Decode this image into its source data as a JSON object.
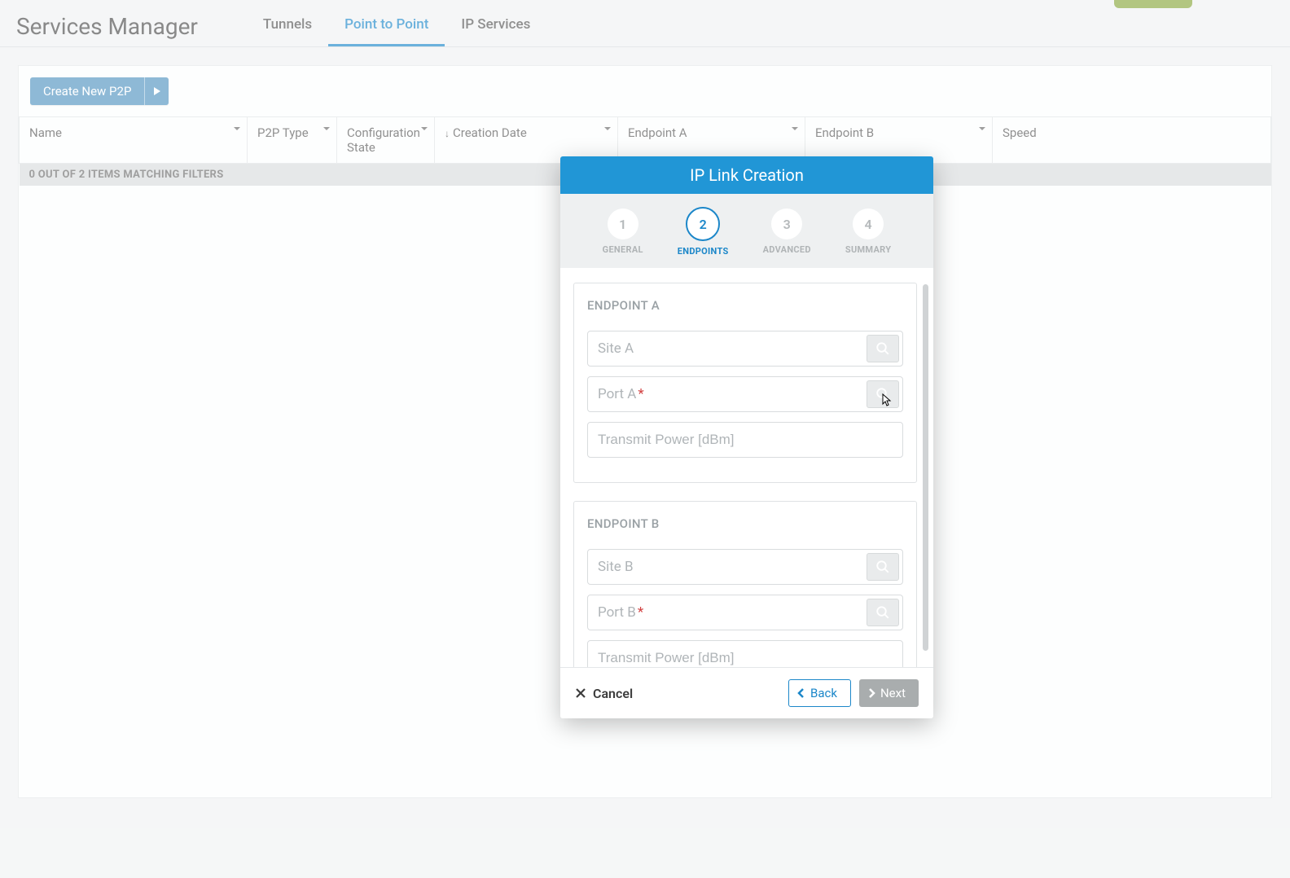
{
  "header": {
    "title": "Services Manager",
    "tabs": [
      "Tunnels",
      "Point to Point",
      "IP Services"
    ],
    "active_tab": 1
  },
  "toolbar": {
    "create_label": "Create New P2P"
  },
  "table": {
    "columns": [
      "Name",
      "P2P Type",
      "Configuration State",
      "Creation Date",
      "Endpoint A",
      "Endpoint B",
      "Speed"
    ],
    "sort_column": 3,
    "filter_text": "0 OUT OF 2 ITEMS MATCHING FILTERS"
  },
  "modal": {
    "title": "IP Link Creation",
    "steps": [
      {
        "num": "1",
        "label": "GENERAL"
      },
      {
        "num": "2",
        "label": "ENDPOINTS"
      },
      {
        "num": "3",
        "label": "ADVANCED"
      },
      {
        "num": "4",
        "label": "SUMMARY"
      }
    ],
    "active_step": 1,
    "endpoint_a": {
      "title": "ENDPOINT A",
      "site_ph": "Site A",
      "port_ph": "Port A",
      "tx_ph": "Transmit Power [dBm]"
    },
    "endpoint_b": {
      "title": "ENDPOINT B",
      "site_ph": "Site B",
      "port_ph": "Port B",
      "tx_ph": "Transmit Power [dBm]"
    },
    "footer": {
      "cancel": "Cancel",
      "back": "Back",
      "next": "Next"
    }
  }
}
